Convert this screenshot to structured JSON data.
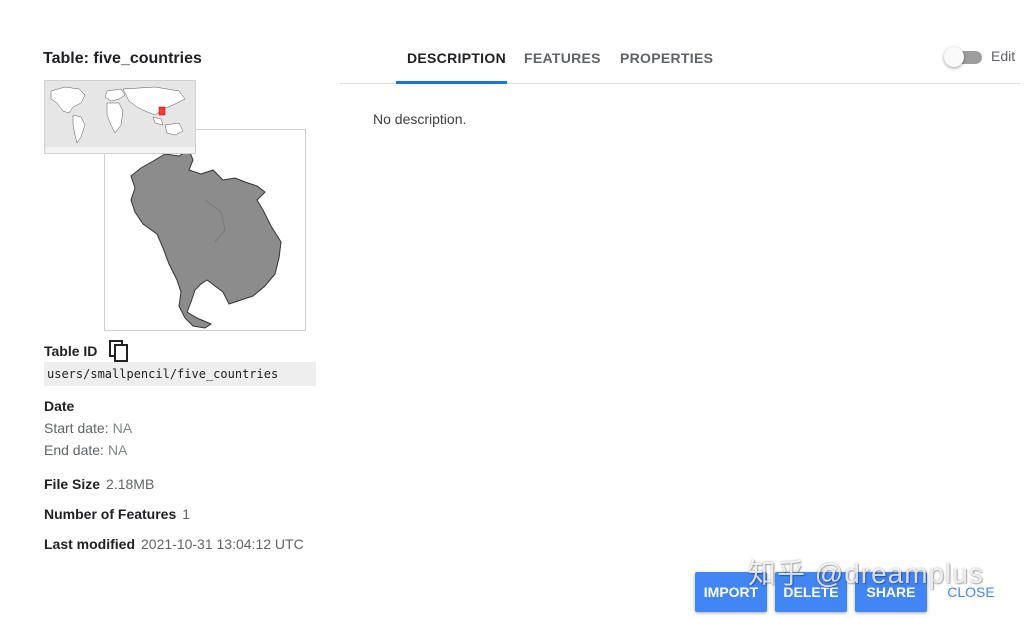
{
  "table": {
    "title": "Table: five_countries"
  },
  "details": {
    "table_id_label": "Table ID",
    "table_id_value": "users/smallpencil/five_countries",
    "date_heading": "Date",
    "start_label": "Start date:",
    "start_value": "NA",
    "end_label": "End date:",
    "end_value": "NA",
    "file_size_label": "File Size",
    "file_size_value": "2.18MB",
    "num_features_label": "Number of Features",
    "num_features_value": "1",
    "last_modified_label": "Last modified",
    "last_modified_value": "2021-10-31 13:04:12 UTC"
  },
  "tabs": [
    {
      "label": "DESCRIPTION",
      "active": true
    },
    {
      "label": "FEATURES",
      "active": false
    },
    {
      "label": "PROPERTIES",
      "active": false
    }
  ],
  "edit_toggle": {
    "label": "Edit",
    "on": false
  },
  "description": {
    "text": "No description."
  },
  "actions": {
    "import": "IMPORT",
    "delete": "DELETE",
    "share": "SHARE",
    "close": "CLOSE"
  },
  "watermark": "知乎 @dreamplus",
  "colors": {
    "accent": "#1a73e8",
    "button": "#4285f4",
    "map_fill": "#8c8c8c",
    "highlight": "#ff3b30"
  }
}
